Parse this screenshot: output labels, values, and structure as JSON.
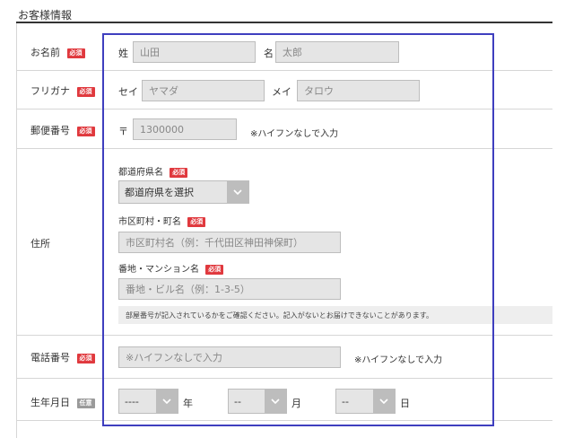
{
  "section_title": "お客様情報",
  "badges": {
    "required": "必須",
    "optional": "任意"
  },
  "rows": {
    "name": {
      "label": "お名前",
      "last_label": "姓",
      "last_placeholder": "山田",
      "first_label": "名",
      "first_placeholder": "太郎"
    },
    "furigana": {
      "label": "フリガナ",
      "last_label": "セイ",
      "last_placeholder": "ヤマダ",
      "first_label": "メイ",
      "first_placeholder": "タロウ"
    },
    "postal": {
      "label": "郵便番号",
      "prefix": "〒",
      "placeholder": "1300000",
      "hint": "※ハイフンなしで入力"
    },
    "address": {
      "label": "住所",
      "prefecture_label": "都道府県名",
      "prefecture_value": "都道府県を選択",
      "city_label": "市区町村・町名",
      "city_placeholder": "市区町村名（例：千代田区神田神保町）",
      "street_label": "番地・マンション名",
      "street_placeholder": "番地・ビル名（例：1-3-5）",
      "notice": "部屋番号が記入されているかをご確認ください。記入がないとお届けできないことがあります。"
    },
    "phone": {
      "label": "電話番号",
      "placeholder": "※ハイフンなしで入力",
      "hint": "※ハイフンなしで入力"
    },
    "birthday": {
      "label": "生年月日",
      "year_value": "----",
      "year_unit": "年",
      "month_value": "--",
      "month_unit": "月",
      "day_value": "--",
      "day_unit": "日"
    }
  },
  "icons": {
    "dropdown": "chevron-down-icon"
  },
  "colors": {
    "badge_required": "#e0393e",
    "badge_optional": "#9a9a9a",
    "highlight": "#3f3fbf"
  }
}
